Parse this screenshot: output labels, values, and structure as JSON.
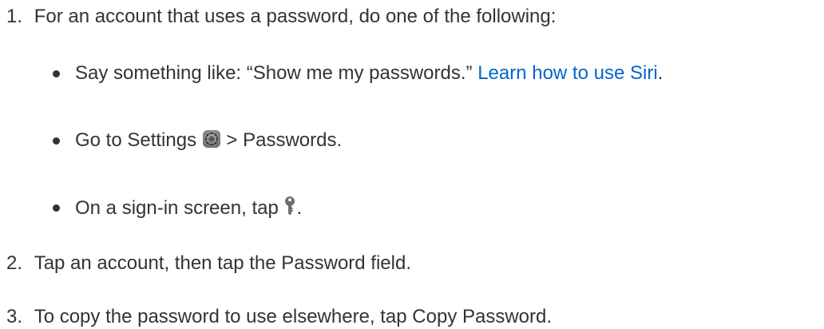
{
  "steps": [
    {
      "number": "1.",
      "text": "For an account that uses a password, do one of the following:",
      "bullets": [
        {
          "text": "Say something like: “Show me my passwords.” ",
          "link": "Learn how to use Siri",
          "after": "."
        },
        {
          "text_before": "Go to Settings ",
          "icon": "settings-gear-icon",
          "text_after": " > Passwords."
        },
        {
          "text_before": "On a sign-in screen, tap ",
          "icon": "key-icon",
          "text_after": "."
        }
      ]
    },
    {
      "number": "2.",
      "text": "Tap an account, then tap the Password field."
    },
    {
      "number": "3.",
      "text": "To copy the password to use elsewhere, tap Copy Password."
    }
  ],
  "colors": {
    "text": "#333336",
    "link": "#0066cc"
  }
}
